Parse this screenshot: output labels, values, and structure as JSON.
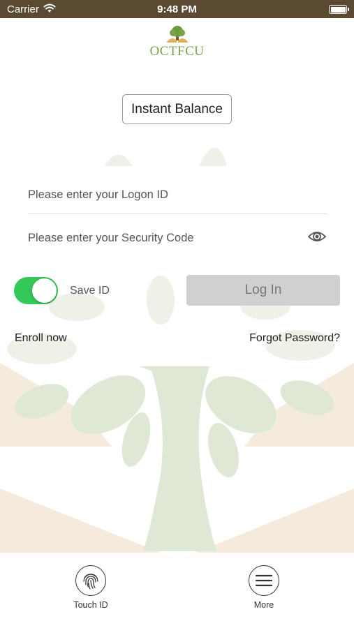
{
  "status_bar": {
    "carrier": "Carrier",
    "time": "9:48 PM"
  },
  "logo": {
    "text": "OCTFCU"
  },
  "instant_balance": {
    "label": "Instant Balance"
  },
  "login_form": {
    "logon_placeholder": "Please enter your Logon ID",
    "security_placeholder": "Please enter your Security Code",
    "save_id_label": "Save ID",
    "save_id_on": true,
    "login_label": "Log In"
  },
  "links": {
    "enroll": "Enroll now",
    "forgot": "Forgot Password?"
  },
  "bottom_bar": {
    "touch_id": "Touch ID",
    "more": "More"
  },
  "colors": {
    "status_bar": "#5a4a32",
    "toggle_on": "#34c759",
    "logo_green": "#7aa14a",
    "tree_green": "#dfe7d5",
    "tree_tan": "#f3e6d4"
  }
}
